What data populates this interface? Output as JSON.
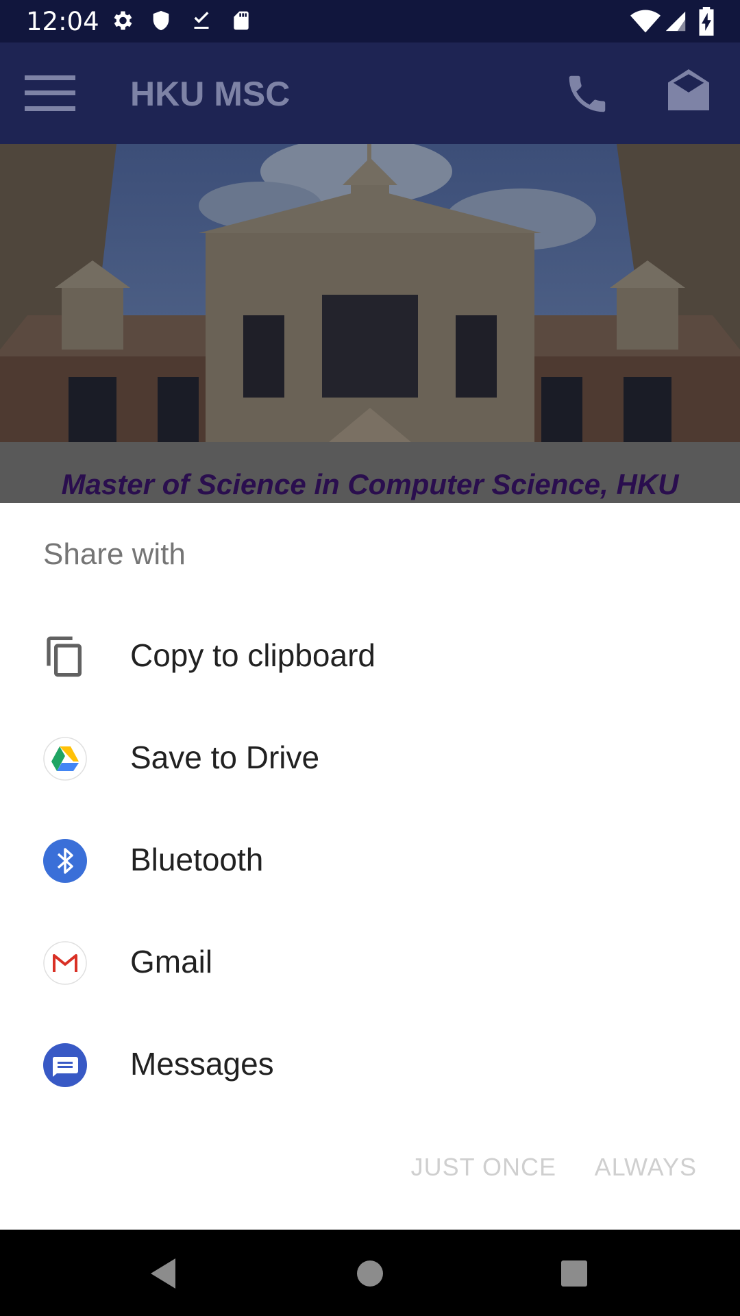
{
  "status_bar": {
    "time": "12:04",
    "left_icons": [
      "settings-icon",
      "shield-icon",
      "download-done-icon",
      "sd-card-icon"
    ],
    "right_icons": [
      "wifi-icon",
      "signal-icon",
      "battery-charging-icon"
    ]
  },
  "app_bar": {
    "title": "HKU MSC",
    "icons": [
      "menu-icon",
      "phone-icon",
      "mail-icon"
    ]
  },
  "caption": "Master of Science in Computer Science, HKU",
  "share_sheet": {
    "header": "Share with",
    "items": [
      {
        "label": "Copy to clipboard",
        "icon": "copy-icon"
      },
      {
        "label": "Save to Drive",
        "icon": "drive-icon"
      },
      {
        "label": "Bluetooth",
        "icon": "bluetooth-icon"
      },
      {
        "label": "Gmail",
        "icon": "gmail-icon"
      },
      {
        "label": "Messages",
        "icon": "messages-icon"
      }
    ],
    "actions": {
      "just_once": "JUST ONCE",
      "always": "ALWAYS"
    }
  },
  "nav_bar": {
    "icons": [
      "back-icon",
      "home-icon",
      "recents-icon"
    ]
  },
  "colors": {
    "status_bar": "#11163d",
    "app_bar_dimmed": "#1e2453",
    "caption_text": "#2a0e4e",
    "sheet_header": "#757575",
    "item_text": "#212121",
    "action_disabled": "#cfcfcf",
    "bluetooth_blue": "#3a6fd8",
    "messages_blue": "#3859c5"
  }
}
